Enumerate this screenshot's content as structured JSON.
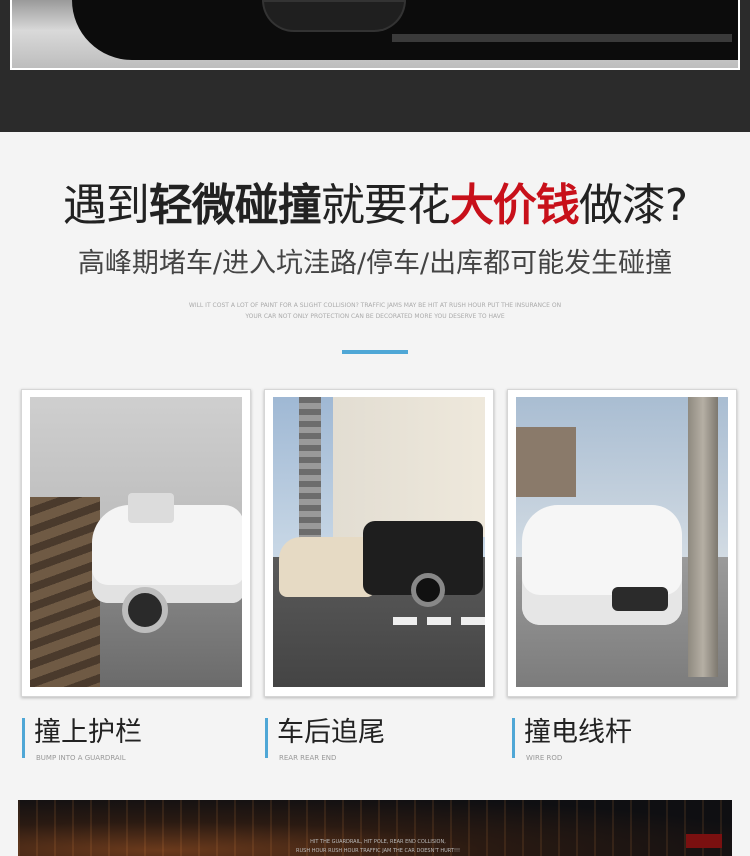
{
  "headline": {
    "part1": "遇到",
    "part2": "轻微碰撞",
    "part3": "就要花",
    "part4": "大价钱",
    "part5": "做漆?"
  },
  "subline": "高峰期堵车/进入坑洼路/停车/出库都可能发生碰撞",
  "fine_print": [
    "WILL IT COST A LOT OF PAINT FOR A SLIGHT COLLISION?  TRAFFIC JAMS MAY BE HIT AT RUSH HOUR PUT THE INSURANCE ON",
    "YOUR CAR NOT ONLY PROTECTION CAN BE DECORATED MORE YOU DESERVE TO HAVE"
  ],
  "cards": [
    {
      "title": "撞上护栏",
      "subtitle": "BUMP INTO A GUARDRAIL"
    },
    {
      "title": "车后追尾",
      "subtitle": "REAR REAR END"
    },
    {
      "title": "撞电线杆",
      "subtitle": "WIRE ROD"
    }
  ],
  "bottom_caption": [
    "HIT THE GUARDRAIL, HIT POLE, REAR END COLLISION,",
    "RUSH HOUR RUSH HOUR TRAFFIC JAM THE CAR DOESN'T HURT!!!"
  ],
  "colors": {
    "accent": "#4fa7d6",
    "highlight_red": "#c8101a",
    "dark_band": "#2b2b2b",
    "background": "#f4f4f4"
  }
}
